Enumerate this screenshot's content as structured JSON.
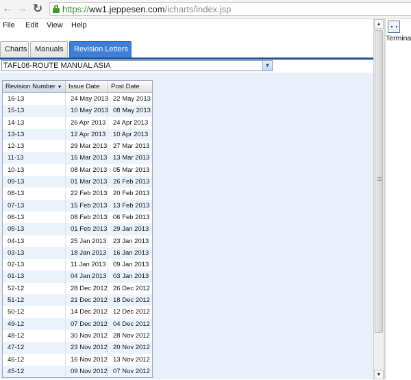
{
  "browser": {
    "url_scheme": "https://",
    "url_host": "ww1.jeppesen.com",
    "url_path": "/icharts/index.jsp"
  },
  "menu": [
    "File",
    "Edit",
    "View",
    "Help"
  ],
  "tabs": [
    {
      "label": "Charts"
    },
    {
      "label": "Manuals"
    },
    {
      "label": "Revision Letters",
      "active": true
    }
  ],
  "manual_select": {
    "value": "TAFL06-ROUTE MANUAL ASIA"
  },
  "table": {
    "columns": [
      "Revision Number",
      "Issue Date",
      "Post Date"
    ],
    "sort_indicator": "▼",
    "rows": [
      [
        "16-13",
        "24 May 2013",
        "22 May 2013"
      ],
      [
        "15-13",
        "10 May 2013",
        "08 May 2013"
      ],
      [
        "14-13",
        "26 Apr 2013",
        "24 Apr 2013"
      ],
      [
        "13-13",
        "12 Apr 2013",
        "10 Apr 2013"
      ],
      [
        "12-13",
        "29 Mar 2013",
        "27 Mar 2013"
      ],
      [
        "11-13",
        "15 Mar 2013",
        "13 Mar 2013"
      ],
      [
        "10-13",
        "08 Mar 2013",
        "05 Mar 2013"
      ],
      [
        "09-13",
        "01 Mar 2013",
        "26 Feb 2013"
      ],
      [
        "08-13",
        "22 Feb 2013",
        "20 Feb 2013"
      ],
      [
        "07-13",
        "15 Feb 2013",
        "13 Feb 2013"
      ],
      [
        "06-13",
        "08 Feb 2013",
        "06 Feb 2013"
      ],
      [
        "05-13",
        "01 Feb 2013",
        "29 Jan 2013"
      ],
      [
        "04-13",
        "25 Jan 2013",
        "23 Jan 2013"
      ],
      [
        "03-13",
        "18 Jan 2013",
        "16 Jan 2013"
      ],
      [
        "02-13",
        "11 Jan 2013",
        "09 Jan 2013"
      ],
      [
        "01-13",
        "04 Jan 2013",
        "03 Jan 2013"
      ],
      [
        "52-12",
        "28 Dec 2012",
        "26 Dec 2012"
      ],
      [
        "51-12",
        "21 Dec 2012",
        "18 Dec 2012"
      ],
      [
        "50-12",
        "14 Dec 2012",
        "12 Dec 2012"
      ],
      [
        "49-12",
        "07 Dec 2012",
        "04 Dec 2012"
      ],
      [
        "48-12",
        "30 Nov 2012",
        "28 Nov 2012"
      ],
      [
        "47-12",
        "23 Nov 2012",
        "20 Nov 2012"
      ],
      [
        "46-12",
        "16 Nov 2012",
        "13 Nov 2012"
      ],
      [
        "45-12",
        "09 Nov 2012",
        "07 Nov 2012"
      ]
    ]
  },
  "right_panel": {
    "label": "Terminal"
  }
}
